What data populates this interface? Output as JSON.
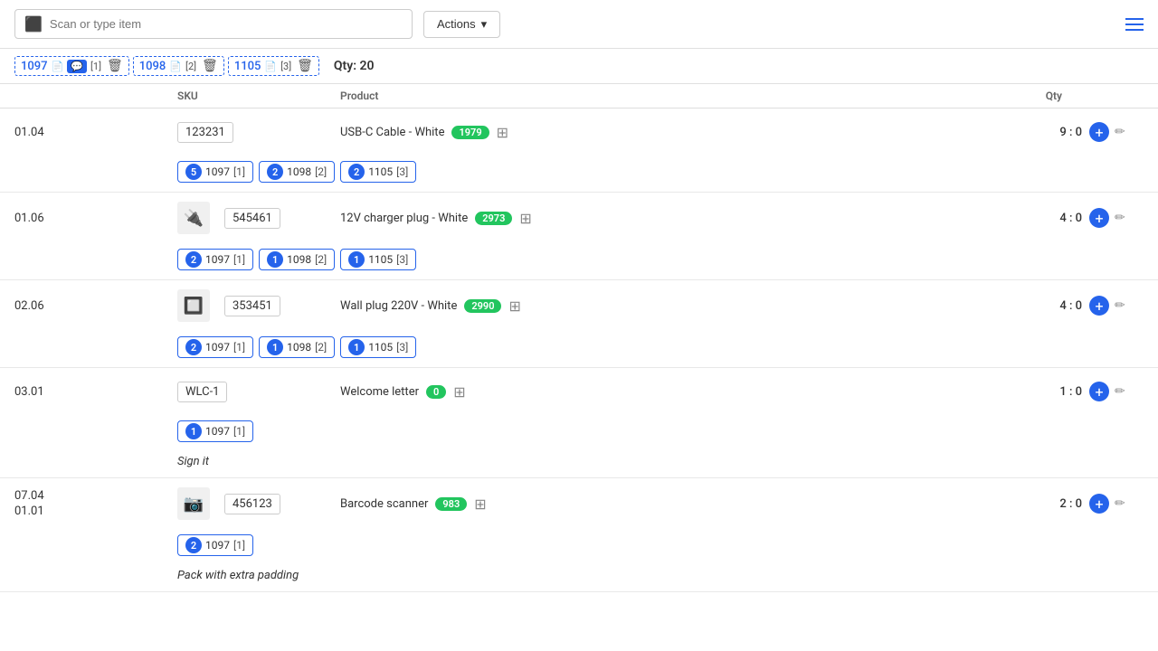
{
  "toolbar": {
    "scan_placeholder": "Scan or type item",
    "actions_label": "Actions",
    "actions_arrow": "▾"
  },
  "order_tabs": [
    {
      "id": "1097",
      "icon": "📄",
      "badge": "[1]",
      "has_comment": true,
      "comment_badge": "[1]"
    },
    {
      "id": "1098",
      "icon": "📄",
      "badge": "[2]"
    },
    {
      "id": "1105",
      "icon": "📄",
      "badge": "[3]"
    }
  ],
  "qty_total": "Qty: 20",
  "table_headers": {
    "col1": "",
    "col2": "SKU",
    "col3": "Product",
    "col4": "Qty",
    "col5": ""
  },
  "rows": [
    {
      "location": "01.04",
      "has_image": false,
      "sku": "123231",
      "product_name": "USB-C Cable - White",
      "badge": "1979",
      "qty": "9 : 0",
      "tags": [
        {
          "num": 5,
          "id": "1097",
          "bracket": "[1]"
        },
        {
          "num": 2,
          "id": "1098",
          "bracket": "[2]"
        },
        {
          "num": 2,
          "id": "1105",
          "bracket": "[3]"
        }
      ],
      "note": ""
    },
    {
      "location": "01.06",
      "has_image": true,
      "image_emoji": "🔌",
      "sku": "545461",
      "product_name": "12V charger plug - White",
      "badge": "2973",
      "qty": "4 : 0",
      "tags": [
        {
          "num": 2,
          "id": "1097",
          "bracket": "[1]"
        },
        {
          "num": 1,
          "id": "1098",
          "bracket": "[2]"
        },
        {
          "num": 1,
          "id": "1105",
          "bracket": "[3]"
        }
      ],
      "note": ""
    },
    {
      "location": "02.06",
      "has_image": true,
      "image_emoji": "🔲",
      "sku": "353451",
      "product_name": "Wall plug 220V - White",
      "badge": "2990",
      "qty": "4 : 0",
      "tags": [
        {
          "num": 2,
          "id": "1097",
          "bracket": "[1]"
        },
        {
          "num": 1,
          "id": "1098",
          "bracket": "[2]"
        },
        {
          "num": 1,
          "id": "1105",
          "bracket": "[3]"
        }
      ],
      "note": ""
    },
    {
      "location": "03.01",
      "has_image": false,
      "sku": "WLC-1",
      "product_name": "Welcome letter",
      "badge": "0",
      "qty": "1 : 0",
      "tags": [
        {
          "num": 1,
          "id": "1097",
          "bracket": "[1]"
        }
      ],
      "note": "Sign it"
    },
    {
      "location_line1": "07.04",
      "location_line2": "01.01",
      "has_image": true,
      "image_emoji": "📷",
      "sku": "456123",
      "product_name": "Barcode scanner",
      "badge": "983",
      "qty": "2 : 0",
      "tags": [
        {
          "num": 2,
          "id": "1097",
          "bracket": "[1]"
        }
      ],
      "note": "Pack with extra padding"
    }
  ]
}
